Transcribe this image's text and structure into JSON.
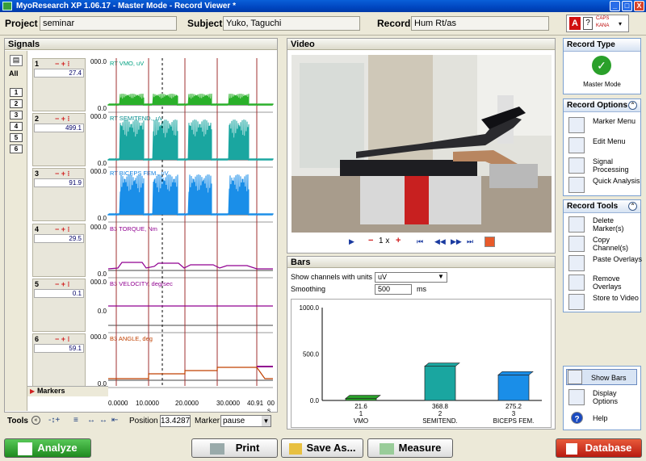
{
  "window": {
    "title": "MyoResearch XP 1.06.17 - Master Mode - Record Viewer *",
    "min": "_",
    "max": "□",
    "close": "X"
  },
  "header": {
    "project_label": "Project",
    "project_value": "seminar",
    "subject_label": "Subject",
    "subject_value": "Yuko, Taguchi",
    "record_label": "Record",
    "record_value": "Hum Rt/as",
    "lang_caps": "CAPS",
    "lang_kana": "KANA"
  },
  "signals": {
    "title": "Signals",
    "all_label": "All",
    "channel_buttons": [
      "1",
      "2",
      "3",
      "4",
      "5",
      "6"
    ],
    "channels": [
      {
        "num": "1",
        "ctl": "− + ⁝",
        "value": "27.4",
        "ytop": "000.0",
        "ymid": "",
        "ybot": "0.0",
        "label": "RT VMO, uV",
        "color": "#00a080"
      },
      {
        "num": "2",
        "ctl": "− + ⁝",
        "value": "499.1",
        "ytop": "000.0",
        "ymid": "",
        "ybot": "0.0",
        "label": "RT SEMITEND., uV",
        "color": "#008c8c"
      },
      {
        "num": "3",
        "ctl": "− + ⁝",
        "value": "91.9",
        "ytop": "000.0",
        "ymid": "",
        "ybot": "0.0",
        "label": "RT BICEPS FEM., uV",
        "color": "#1080e0"
      },
      {
        "num": "4",
        "ctl": "− + ⁝",
        "value": "29.5",
        "ytop": "000.0",
        "ymid": "",
        "ybot": "0.0",
        "label": "B3 TORQUE, Nm",
        "color": "#900090"
      },
      {
        "num": "5",
        "ctl": "− + ⁝",
        "value": "0.1",
        "ytop": "000.0",
        "ymid": "0.0",
        "ybot": "",
        "label": "B3 VELOCITY, deg/sec",
        "color": "#900090"
      },
      {
        "num": "6",
        "ctl": "− + ⁝",
        "value": "59.1",
        "ytop": "000.0",
        "ymid": "",
        "ybot": "0.0",
        "label": "B3 ANGLE, deg",
        "color": "#c04000"
      }
    ],
    "markers_label": "Markers",
    "x_ticks": [
      "0.0000",
      "10.0000",
      "20.0000",
      "30.0000",
      "40.91",
      "00 s"
    ]
  },
  "tools": {
    "label": "Tools",
    "position_label": "Position",
    "position_value": "13.4287",
    "marker_label": "Marker",
    "marker_value": "pause"
  },
  "video": {
    "title": "Video",
    "speed": "1 x"
  },
  "bars": {
    "title": "Bars",
    "units_label": "Show channels with units",
    "units_value": "uV",
    "smoothing_label": "Smoothing",
    "smoothing_value": "500",
    "smoothing_unit": "ms",
    "y_ticks": [
      "1000.0",
      "500.0",
      "0.0"
    ],
    "ylim": [
      0,
      1000
    ],
    "items": [
      {
        "value": "21.6",
        "num": "1",
        "name": "VMO",
        "v": 21.6,
        "color": "#2aa02a"
      },
      {
        "value": "368.8",
        "num": "2",
        "name": "SEMITEND.",
        "v": 368.8,
        "color": "#1aa6a0"
      },
      {
        "value": "275.2",
        "num": "3",
        "name": "BICEPS FEM.",
        "v": 275.2,
        "color": "#1a8ee8"
      }
    ]
  },
  "right": {
    "record_type": {
      "title": "Record Type",
      "mode": "Master Mode"
    },
    "options": {
      "title": "Record Options",
      "items": [
        "Marker Menu",
        "Edit Menu",
        "Signal Processing",
        "Quick Analysis"
      ]
    },
    "tools": {
      "title": "Record Tools",
      "items": [
        "Delete Marker(s)",
        "Copy Channel(s)",
        "Paste Overlays",
        "Remove Overlays",
        "Store to Video"
      ]
    },
    "extra": {
      "items": [
        "Show Bars",
        "Display Options",
        "Help"
      ]
    }
  },
  "bottom": {
    "analyze": "Analyze",
    "print": "Print",
    "save_as": "Save As...",
    "measure": "Measure",
    "database": "Database"
  }
}
